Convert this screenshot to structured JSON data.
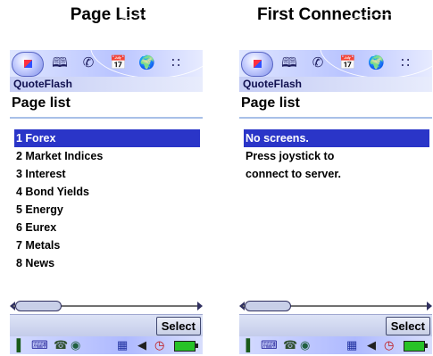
{
  "panels": [
    {
      "title": "Page List",
      "app_name": "QuoteFlash",
      "heading": "Page list",
      "items": [
        {
          "label": "1 Forex",
          "selected": true
        },
        {
          "label": "2 Market Indices",
          "selected": false
        },
        {
          "label": "3 Interest",
          "selected": false
        },
        {
          "label": "4 Bond Yields",
          "selected": false
        },
        {
          "label": "5 Energy",
          "selected": false
        },
        {
          "label": "6 Eurex",
          "selected": false
        },
        {
          "label": "7 Metals",
          "selected": false
        },
        {
          "label": "8 News",
          "selected": false
        }
      ],
      "softkey": "Select"
    },
    {
      "title": "First Connection",
      "app_name": "QuoteFlash",
      "heading": "Page list",
      "items": [
        {
          "label": "No screens.",
          "selected": true
        },
        {
          "label": "Press joystick to",
          "selected": false
        },
        {
          "label": "connect to server.",
          "selected": false
        }
      ],
      "softkey": "Select"
    }
  ],
  "top_icons": [
    "home-icon",
    "book-icon",
    "phone-icon",
    "calendar-icon",
    "web-icon",
    "apps-grid-icon"
  ],
  "status_icons": [
    "signal-icon",
    "keyboard-icon",
    "connectivity-icon",
    "globe-icon",
    "memo-icon",
    "volume-icon",
    "clock-icon",
    "battery-icon"
  ],
  "colors": {
    "selection": "#2a35c8",
    "topbar": "#b9c4ff",
    "battery": "#27c227"
  }
}
